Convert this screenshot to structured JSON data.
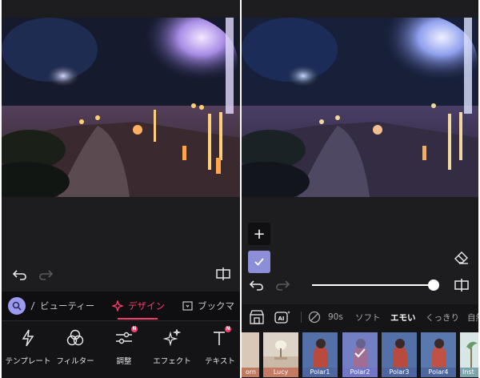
{
  "colors": {
    "background": "#1d1d1f",
    "accent": "#ff3d6e",
    "selection": "#8d8ed8"
  },
  "left_panel": {
    "tabs": [
      {
        "label": "ビューティー",
        "icon": "beauty-icon"
      },
      {
        "label": "デザイン",
        "icon": "sparkle-icon",
        "active": true
      },
      {
        "label": "ブックマ",
        "icon": "bookmark-icon"
      }
    ],
    "tools": [
      {
        "label": "テンプレート",
        "icon": "lightning-icon"
      },
      {
        "label": "フィルター",
        "icon": "filter-circles-icon"
      },
      {
        "label": "調整",
        "icon": "adjust-sliders-icon",
        "badge": "N"
      },
      {
        "label": "エフェクト",
        "icon": "effect-sparkles-icon"
      },
      {
        "label": "テキスト",
        "icon": "text-icon",
        "badge": "N"
      }
    ]
  },
  "right_panel": {
    "add_label": "+",
    "intensity": 1.0,
    "categories": [
      {
        "label": "90s"
      },
      {
        "label": "ソフト"
      },
      {
        "label": "エモい",
        "active": true
      },
      {
        "label": "くっきり"
      },
      {
        "label": "自然"
      }
    ],
    "filters": [
      {
        "label": "orn"
      },
      {
        "label": "Lucy"
      },
      {
        "label": "Polar1"
      },
      {
        "label": "Polar2",
        "selected": true
      },
      {
        "label": "Polar3"
      },
      {
        "label": "Polar4"
      },
      {
        "label": "Inst"
      }
    ]
  }
}
